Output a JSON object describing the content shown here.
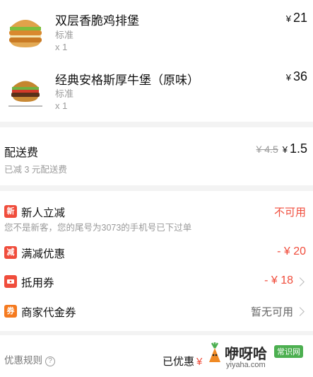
{
  "items": [
    {
      "name": "双层香脆鸡排堡",
      "spec": "标准",
      "qty": "x 1",
      "price": "21",
      "currency": "¥"
    },
    {
      "name": "经典安格斯厚牛堡（原味）",
      "spec": "标准",
      "qty": "x 1",
      "price": "36",
      "currency": "¥"
    }
  ],
  "delivery": {
    "label": "配送费",
    "original": "¥ 4.5",
    "price": "1.5",
    "currency": "¥",
    "note": "已减 3 元配送费"
  },
  "promos": {
    "new_user": {
      "badge": "新",
      "label": "新人立减",
      "value": "不可用",
      "note": "您不是新客，您的尾号为3073的手机号已下过单",
      "badge_color": "#f04d3c"
    },
    "discount": {
      "badge": "减",
      "label": "满减优惠",
      "value": "- ¥ 20",
      "badge_color": "#f04d3c"
    },
    "coupon": {
      "label": "抵用券",
      "value": "- ¥ 18",
      "badge_color": "#f04d3c"
    },
    "merchant_voucher": {
      "badge": "券",
      "label": "商家代金券",
      "value": "暂无可用",
      "badge_color": "#f57a1f"
    }
  },
  "footer": {
    "rules_label": "优惠规则",
    "help_glyph": "?",
    "saved_label": "已优惠",
    "saved_currency": "¥"
  },
  "watermark": {
    "brand": "咿呀哈",
    "tag": "常识网",
    "site": "yiyaha.com"
  },
  "colors": {
    "accent_red": "#f04d3c",
    "orange": "#f57a1f",
    "muted": "#9a9a9a"
  }
}
